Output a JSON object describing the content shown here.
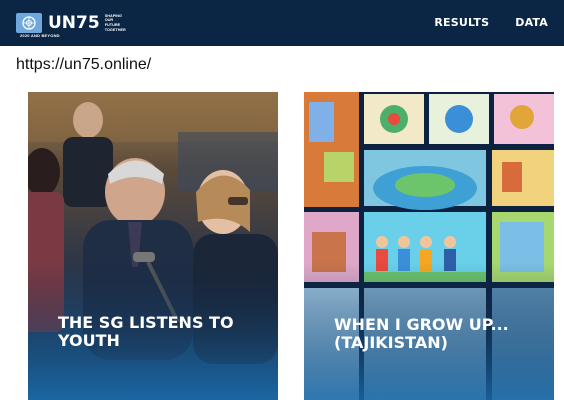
{
  "header": {
    "logo_text": "UN75",
    "logo_tagline": [
      "SHAPING",
      "OUR",
      "FUTURE",
      "TOGETHER"
    ],
    "logo_subtitle": "2020 AND BEYOND",
    "nav": [
      {
        "label": "RESULTS"
      },
      {
        "label": "DATA"
      }
    ]
  },
  "page": {
    "url": "https://un75.online/"
  },
  "cards": [
    {
      "title": "THE SG LISTENS TO YOUTH",
      "title_lines": [
        "THE SG LISTENS TO",
        "YOUTH"
      ]
    },
    {
      "title": "WHEN I GROW UP... (TAJIKISTAN)",
      "title_lines": [
        "WHEN I GROW UP...",
        "(TAJIKISTAN)"
      ]
    }
  ],
  "colors": {
    "header_bg": "#0b2545",
    "accent": "#1b5f94"
  }
}
